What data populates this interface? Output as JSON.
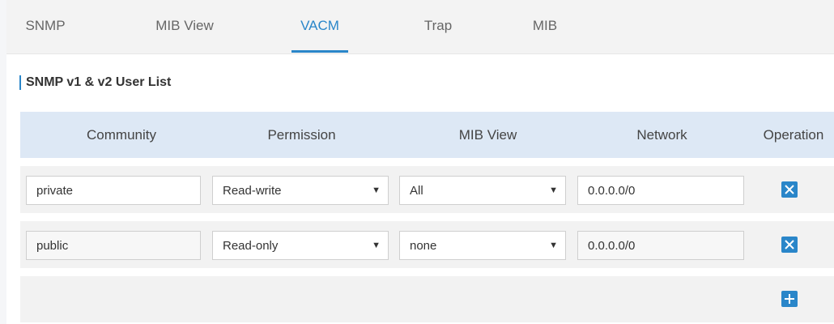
{
  "tabs": [
    {
      "label": "SNMP",
      "active": false
    },
    {
      "label": "MIB View",
      "active": false
    },
    {
      "label": "VACM",
      "active": true
    },
    {
      "label": "Trap",
      "active": false
    },
    {
      "label": "MIB",
      "active": false
    }
  ],
  "section": {
    "title": "SNMP v1 & v2 User List"
  },
  "table": {
    "headers": {
      "community": "Community",
      "permission": "Permission",
      "mib_view": "MIB View",
      "network": "Network",
      "operation": "Operation"
    },
    "rows": [
      {
        "community": "private",
        "permission": "Read-write",
        "mib_view": "All",
        "network": "0.0.0.0/0"
      },
      {
        "community": "public",
        "permission": "Read-only",
        "mib_view": "none",
        "network": "0.0.0.0/0"
      }
    ]
  },
  "icons": {
    "delete": "close-icon",
    "add": "plus-icon",
    "dropdown": "chevron-down-icon"
  },
  "colors": {
    "accent": "#2a86c9",
    "header_bg": "#dde8f5",
    "row_bg": "#f2f2f2"
  }
}
